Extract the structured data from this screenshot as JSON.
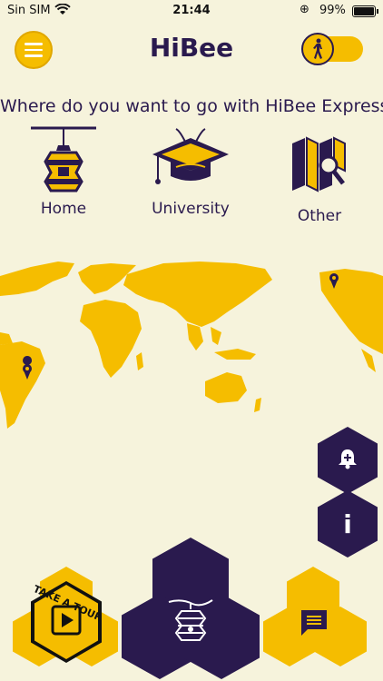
{
  "status_bar": {
    "carrier": "Sin SIM",
    "time": "21:44",
    "battery": "99%",
    "battery_level": 0.99
  },
  "header": {
    "title": "HiBee",
    "menu_icon": "hamburger-menu-icon",
    "toggle_icon": "walking-person-icon"
  },
  "question": "Where do you want to go with HiBee Express?",
  "destinations": [
    {
      "label": "Home",
      "icon": "beehive-lantern-icon"
    },
    {
      "label": "University",
      "icon": "graduation-cap-icon"
    },
    {
      "label": "Other",
      "icon": "map-search-icon"
    }
  ],
  "map": {
    "land_color": "#f5bd00",
    "pin_color": "#2a1a4e"
  },
  "side_buttons": {
    "add_alert_icon": "bell-plus-icon",
    "info_label": "i"
  },
  "bottom_nav": {
    "tour_label": "TAKE A TOUR",
    "tour_icon": "play-icon",
    "center_icon": "hive-home-icon",
    "chat_icon": "chat-message-icon"
  },
  "colors": {
    "background": "#f6f3dc",
    "accent": "#f5bd00",
    "primary": "#2a1a4e"
  }
}
